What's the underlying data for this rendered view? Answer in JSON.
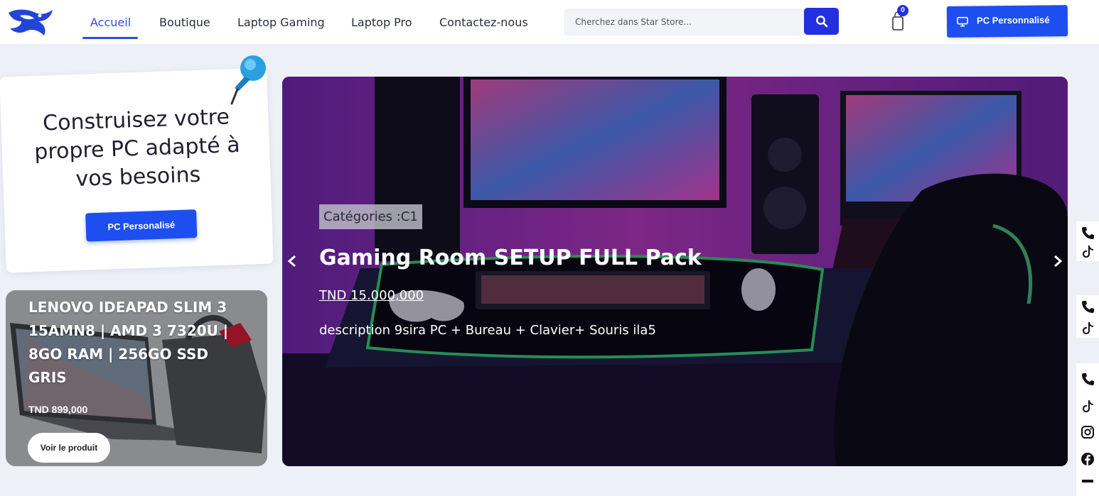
{
  "nav": {
    "items": [
      {
        "label": "Accueil",
        "active": true
      },
      {
        "label": "Boutique"
      },
      {
        "label": "Laptop Gaming"
      },
      {
        "label": "Laptop Pro"
      },
      {
        "label": "Contactez-nous"
      }
    ],
    "search_placeholder": "Cherchez dans Star Store...",
    "cart_count": "0",
    "pc_button_label": "PC Personnalisé"
  },
  "build_card": {
    "title": "Construisez votre propre PC adapté à vos besoins",
    "button_label": "PC Personalisé"
  },
  "laptop_card": {
    "title": "LENOVO IDEAPAD SLIM 3 15AMN8 | AMD 3 7320U | 8GO RAM | 256GO SSD GRIS",
    "price": "TND 899,000",
    "button_label": "Voir le produit"
  },
  "hero": {
    "category": "Catégories :C1",
    "title": "Gaming Room SETUP FULL Pack",
    "price": "TND 15.000,000",
    "description": "description 9sira PC + Bureau + Clavier+ Souris ila5"
  },
  "colors": {
    "primary": "#1d4ff0",
    "nav_active": "#2f4de0",
    "page_bg": "#eef0f8"
  },
  "icons": {
    "side": [
      "phone-icon",
      "tiktok-icon",
      "instagram-icon",
      "facebook-icon"
    ]
  }
}
